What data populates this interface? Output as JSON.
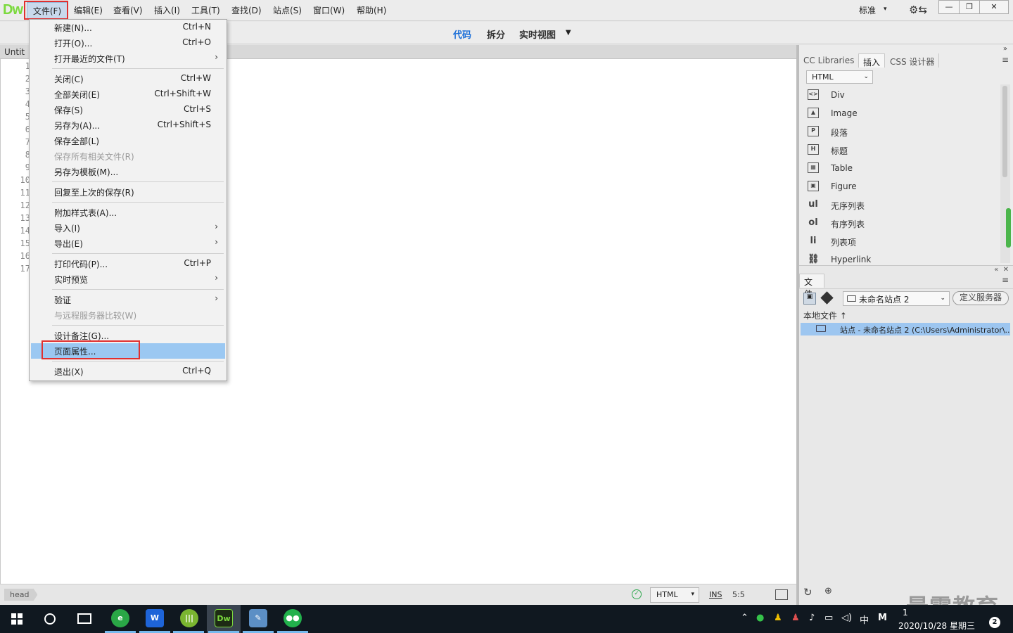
{
  "app": {
    "logo": "Dw"
  },
  "menubar": {
    "items": [
      "文件(F)",
      "编辑(E)",
      "查看(V)",
      "插入(I)",
      "工具(T)",
      "查找(D)",
      "站点(S)",
      "窗口(W)",
      "帮助(H)"
    ],
    "workspace": "标准"
  },
  "toolbar": {
    "code": "代码",
    "split": "拆分",
    "live": "实时视图"
  },
  "document": {
    "tab": "Untit",
    "line_numbers": [
      "1",
      "2",
      "3",
      "4",
      "5",
      "6",
      "7",
      "8",
      "9",
      "10",
      "11",
      "12",
      "13",
      "14",
      "15",
      "16",
      "17"
    ]
  },
  "file_menu": {
    "items": [
      {
        "label": "新建(N)...",
        "shortcut": "Ctrl+N"
      },
      {
        "label": "打开(O)...",
        "shortcut": "Ctrl+O"
      },
      {
        "label": "打开最近的文件(T)",
        "arrow": "›"
      },
      {
        "label": "关闭(C)",
        "shortcut": "Ctrl+W"
      },
      {
        "label": "全部关闭(E)",
        "shortcut": "Ctrl+Shift+W"
      },
      {
        "label": "保存(S)",
        "shortcut": "Ctrl+S"
      },
      {
        "label": "另存为(A)...",
        "shortcut": "Ctrl+Shift+S"
      },
      {
        "label": "保存全部(L)"
      },
      {
        "label": "保存所有相关文件(R)",
        "disabled": true
      },
      {
        "label": "另存为模板(M)..."
      },
      {
        "label": "回复至上次的保存(R)"
      },
      {
        "label": "附加样式表(A)..."
      },
      {
        "label": "导入(I)",
        "arrow": "›"
      },
      {
        "label": "导出(E)",
        "arrow": "›"
      },
      {
        "label": "打印代码(P)...",
        "shortcut": "Ctrl+P"
      },
      {
        "label": "实时预览",
        "arrow": "›"
      },
      {
        "label": "验证",
        "arrow": "›"
      },
      {
        "label": "与远程服务器比较(W)",
        "disabled": true
      },
      {
        "label": "设计备注(G)..."
      },
      {
        "label": "页面属性...",
        "active": true
      },
      {
        "label": "退出(X)",
        "shortcut": "Ctrl+Q"
      }
    ]
  },
  "status": {
    "tag": "head",
    "language": "HTML",
    "mode": "INS",
    "cursor": "5:5"
  },
  "insert_panel": {
    "tabs": [
      "CC Libraries",
      "插入",
      "CSS 设计器"
    ],
    "category": "HTML",
    "items": [
      {
        "label": "Div",
        "icon": "div-icon",
        "glyph": "<>"
      },
      {
        "label": "Image",
        "icon": "image-icon",
        "glyph": "▲"
      },
      {
        "label": "段落",
        "icon": "paragraph-icon",
        "glyph": "P"
      },
      {
        "label": "标题",
        "icon": "heading-icon",
        "glyph": "H"
      },
      {
        "label": "Table",
        "icon": "table-icon",
        "glyph": "▦"
      },
      {
        "label": "Figure",
        "icon": "figure-icon",
        "glyph": "▣"
      },
      {
        "label": "无序列表",
        "icon": "ul-icon",
        "glyph": "ul"
      },
      {
        "label": "有序列表",
        "icon": "ol-icon",
        "glyph": "ol"
      },
      {
        "label": "列表项",
        "icon": "li-icon",
        "glyph": "li"
      },
      {
        "label": "Hyperlink",
        "icon": "hyperlink-icon",
        "glyph": "⛓"
      }
    ]
  },
  "files_panel": {
    "tab": "文件",
    "site": "未命名站点 2",
    "define_server": "定义服务器",
    "local_label": "本地文件 ↑",
    "row": "站点 - 未命名站点 2 (C:\\Users\\Administrator\\..."
  },
  "taskbar": {
    "time": "1",
    "date": "2020/10/28 星期三",
    "ime": "中",
    "notify_count": "2"
  },
  "watermark": "最需教育",
  "colors": {
    "accent": "#1a6ed8",
    "highlight": "#9bc8f2",
    "red_box": "#e03030"
  }
}
